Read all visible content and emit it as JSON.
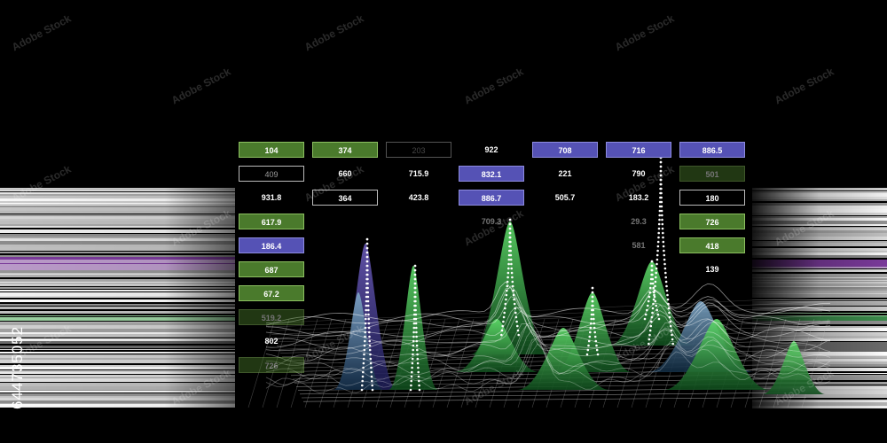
{
  "stock_id": "644735052",
  "watermark_text": "Adobe Stock",
  "colors": {
    "background": "#000000",
    "green_cell": "#4a7a2c",
    "blue_cell": "#5552b5",
    "wave_green": "#2faa4a",
    "streak_purple": "#7a3a9a"
  },
  "cells": [
    {
      "text": "104",
      "style": "green"
    },
    {
      "text": "409",
      "style": "outline"
    },
    {
      "text": "931.8",
      "style": "plain"
    },
    {
      "text": "617.9",
      "style": "green"
    },
    {
      "text": "186.4",
      "style": "blue"
    },
    {
      "text": "687",
      "style": "green"
    },
    {
      "text": "67.2",
      "style": "green"
    },
    {
      "text": "519.2",
      "style": "green"
    },
    {
      "text": "802",
      "style": "plain"
    },
    {
      "text": "726",
      "style": "green"
    },
    {
      "text": "374",
      "style": "green"
    },
    {
      "text": "660",
      "style": "plain"
    },
    {
      "text": "364",
      "style": "outline"
    },
    {
      "text": "203",
      "style": "outline"
    },
    {
      "text": "715.9",
      "style": "plain"
    },
    {
      "text": "423.8",
      "style": "plain"
    },
    {
      "text": "922",
      "style": "plain"
    },
    {
      "text": "832.1",
      "style": "blue"
    },
    {
      "text": "886.7",
      "style": "blue"
    },
    {
      "text": "709.3",
      "style": "plain"
    },
    {
      "text": "708",
      "style": "blue"
    },
    {
      "text": "221",
      "style": "plain"
    },
    {
      "text": "505.7",
      "style": "plain"
    },
    {
      "text": "716",
      "style": "blue"
    },
    {
      "text": "790",
      "style": "plain"
    },
    {
      "text": "183.2",
      "style": "plain"
    },
    {
      "text": "29.3",
      "style": "plain"
    },
    {
      "text": "581",
      "style": "plain"
    },
    {
      "text": "886.5",
      "style": "blue"
    },
    {
      "text": "501",
      "style": "green"
    },
    {
      "text": "180",
      "style": "outline"
    },
    {
      "text": "726",
      "style": "green"
    },
    {
      "text": "418",
      "style": "green"
    },
    {
      "text": "139",
      "style": "plain"
    }
  ]
}
